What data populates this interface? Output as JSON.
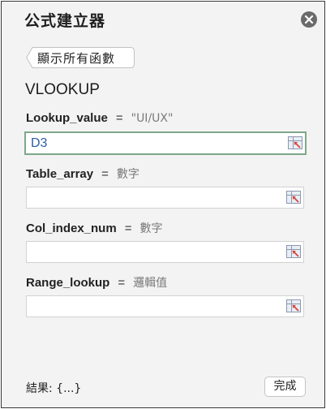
{
  "panel": {
    "title": "公式建立器",
    "back_label": "顯示所有函數"
  },
  "function": {
    "name": "VLOOKUP"
  },
  "args": [
    {
      "name": "Lookup_value",
      "equals": "=",
      "hint": "\"UI/UX\"",
      "value": "D3"
    },
    {
      "name": "Table_array",
      "equals": "=",
      "hint": "數字",
      "value": ""
    },
    {
      "name": "Col_index_num",
      "equals": "=",
      "hint": "數字",
      "value": ""
    },
    {
      "name": "Range_lookup",
      "equals": "=",
      "hint": "邏輯值",
      "value": ""
    }
  ],
  "footer": {
    "result_label": "結果:",
    "result_value": "{...}",
    "done_label": "完成"
  },
  "colors": {
    "active_border": "#7fa78a",
    "value_text": "#2f5ea8"
  },
  "icons": {
    "close": "close-icon",
    "back": "back-chevron-icon",
    "range_picker": "range-select-icon"
  }
}
